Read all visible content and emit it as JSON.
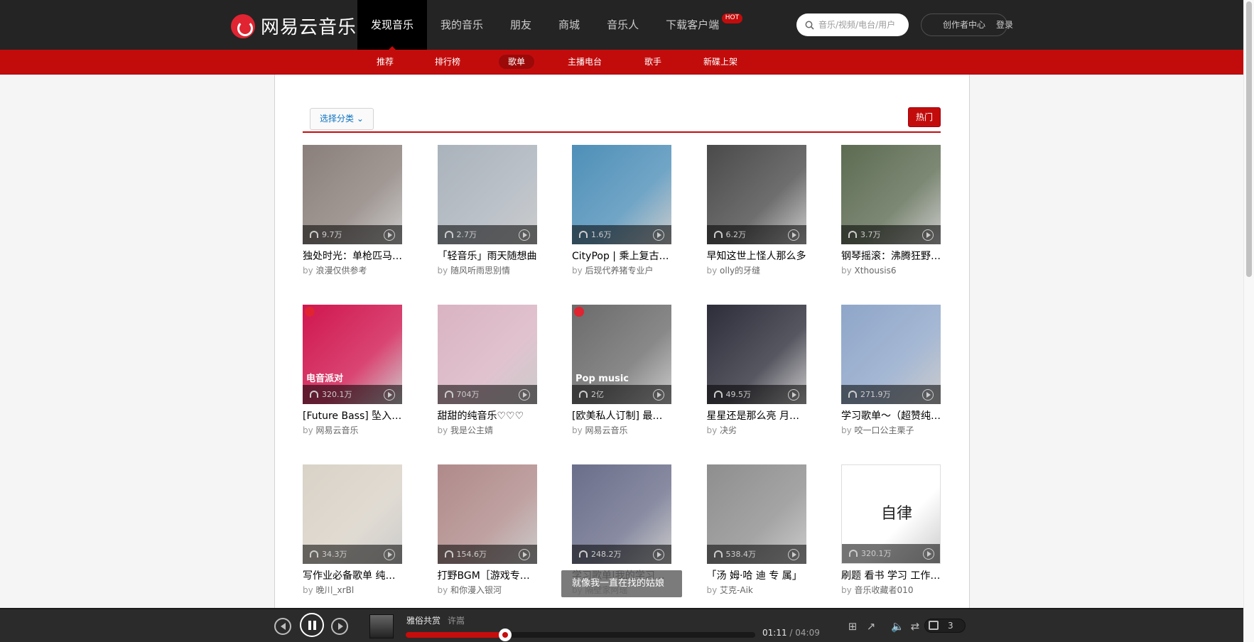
{
  "brand": {
    "name": "网易云音乐"
  },
  "nav": [
    {
      "label": "发现音乐",
      "active": true
    },
    {
      "label": "我的音乐"
    },
    {
      "label": "朋友"
    },
    {
      "label": "商城"
    },
    {
      "label": "音乐人"
    },
    {
      "label": "下载客户端",
      "badge": "HOT"
    }
  ],
  "search": {
    "placeholder": "音乐/视频/电台/用户"
  },
  "creator_center": "创作者中心",
  "login": "登录",
  "subnav": [
    {
      "label": "推荐"
    },
    {
      "label": "排行榜"
    },
    {
      "label": "歌单",
      "active": true
    },
    {
      "label": "主播电台"
    },
    {
      "label": "歌手"
    },
    {
      "label": "新碟上架"
    }
  ],
  "toolbar": {
    "category_button": "选择分类",
    "hot_button": "热门"
  },
  "playlists": [
    {
      "plays": "9.7万",
      "title": "独处时光：单枪匹马也能行走天涯",
      "by": "by",
      "author": "浪漫仅供参考",
      "color": "#8a7f7a"
    },
    {
      "plays": "2.7万",
      "title": "「轻音乐」雨天随想曲",
      "by": "by",
      "author": "随风听雨思别情",
      "color": "#aab2bb"
    },
    {
      "plays": "1.6万",
      "title": "CityPop | 乘上复古列车",
      "by": "by",
      "author": "后现代养猪专业户",
      "color": "#4e8fb8"
    },
    {
      "plays": "6.2万",
      "title": "早知这世上怪人那么多",
      "by": "by",
      "author": "olly的牙缝",
      "color": "#4a4a4a"
    },
    {
      "plays": "3.7万",
      "title": "钢琴摇滚：沸腾狂野的琴键",
      "by": "by",
      "author": "Xthousis6",
      "color": "#5d6b52"
    },
    {
      "plays": "320.1万",
      "title": "[Future Bass] 坠入未来",
      "by": "by",
      "author": "网易云音乐",
      "color": "#d0164f",
      "tag": "电音派对",
      "official": true
    },
    {
      "plays": "704万",
      "title": "甜甜的纯音乐♡♡♡",
      "by": "by",
      "author": "我是公主婧",
      "color": "#d9b3c2"
    },
    {
      "plays": "2亿",
      "title": "[欧美私人订制] 最懂你的欧美推荐",
      "by": "by",
      "author": "网易云音乐",
      "color": "#6b6b6b",
      "tag": "Pop music",
      "official": true
    },
    {
      "plays": "49.5万",
      "title": "星星还是那么亮 月亮还是那么圆",
      "by": "by",
      "author": "决劣",
      "color": "#2d2d3a"
    },
    {
      "plays": "271.9万",
      "title": "学习歌单～（超赞纯音乐）",
      "by": "by",
      "author": "咬一口公主栗子",
      "color": "#8fa6c9"
    },
    {
      "plays": "34.3万",
      "title": "写作业必备歌单 纯音乐",
      "by": "by",
      "author": "晚川_xrBl",
      "color": "#d9d2c7"
    },
    {
      "plays": "154.6万",
      "title": "打野BGM［游戏专用］",
      "by": "by",
      "author": "和你漫入银河",
      "color": "#b08a8a"
    },
    {
      "plays": "248.2万",
      "title": "学习歌单|我的学习时光",
      "by": "by",
      "author": "隔壁家阿瑶",
      "color": "#6a6e8a"
    },
    {
      "plays": "538.4万",
      "title": "「汤 姆·哈 迪 专 属」",
      "by": "by",
      "author": "艾克-Aik",
      "color": "#8e8e8e"
    },
    {
      "plays": "320.1万",
      "title": "刷题 看书 学习 工作 专用",
      "by": "by",
      "author": "音乐收藏者010",
      "color": "#ffffff",
      "tag": "自律"
    }
  ],
  "tooltip": "就像我一直在找的姑娘",
  "player": {
    "song": "雅俗共赏",
    "singer": "许嵩",
    "current_time": "01:11",
    "total_time": "04:09",
    "progress": 0.285,
    "playlist_count": "3"
  }
}
